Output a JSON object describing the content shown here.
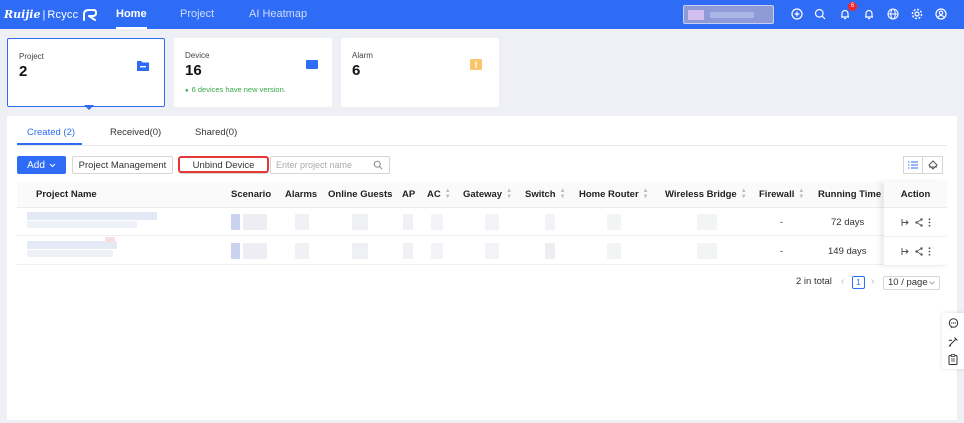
{
  "app": {
    "brand_left": "Ruijie",
    "brand_separator": "|",
    "brand_right": "Rcycc",
    "nav_tabs": [
      {
        "label": "Home",
        "active": true
      },
      {
        "label": "Project",
        "active": false
      },
      {
        "label": "AI Heatmap",
        "active": false
      }
    ],
    "notification_count": "6",
    "top_icons": [
      "add-circle-icon",
      "search-icon",
      "notification-bell-icon",
      "alert-bell-icon",
      "globe-icon",
      "settings-icon",
      "user-icon"
    ]
  },
  "cards": [
    {
      "label": "Project",
      "value": "2",
      "note": "",
      "icon": "folder-icon"
    },
    {
      "label": "Device",
      "value": "16",
      "note": "6 devices have new version.",
      "icon": "device-icon"
    },
    {
      "label": "Alarm",
      "value": "6",
      "note": "",
      "icon": "alarm-icon"
    }
  ],
  "tabs": [
    {
      "label": "Created (2)",
      "active": true
    },
    {
      "label": "Received(0)",
      "active": false
    },
    {
      "label": "Shared(0)",
      "active": false
    }
  ],
  "toolbar": {
    "add_label": "Add",
    "project_management_label": "Project Management",
    "unbind_device_label": "Unbind Device",
    "search_placeholder": "Enter project name"
  },
  "table": {
    "columns": [
      "Project Name",
      "Scenario",
      "Alarms",
      "Online Guests",
      "AP",
      "AC",
      "Gateway",
      "Switch",
      "Home Router",
      "Wireless Bridge",
      "Firewall",
      "Running Time",
      "Action"
    ],
    "rows": [
      {
        "firewall": "-",
        "running_time": "72 days"
      },
      {
        "firewall": "-",
        "running_time": "149 days"
      }
    ]
  },
  "pagination": {
    "total": "2 in total",
    "current_page": "1",
    "page_size": "10 / page"
  },
  "colors": {
    "primary": "#2f6cf6",
    "highlight": "#e53935",
    "success": "#35a84a",
    "alarm": "#f5a623"
  }
}
